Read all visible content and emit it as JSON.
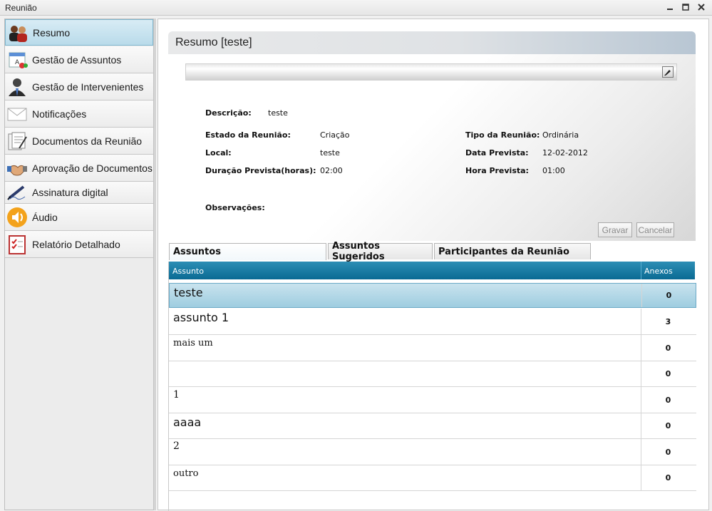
{
  "window": {
    "title": "Reunião"
  },
  "sidebar": {
    "items": [
      {
        "label": "Resumo",
        "icon": "people-icon"
      },
      {
        "label": "Gestão de Assuntos",
        "icon": "topics-icon"
      },
      {
        "label": "Gestão de Intervenientes",
        "icon": "person-icon"
      },
      {
        "label": "Notificações",
        "icon": "envelope-icon"
      },
      {
        "label": "Documentos da Reunião",
        "icon": "documents-icon"
      },
      {
        "label": "Aprovação de Documentos",
        "icon": "handshake-icon"
      },
      {
        "label": "Assinatura digital",
        "icon": "pen-icon"
      },
      {
        "label": "Áudio",
        "icon": "speaker-icon"
      },
      {
        "label": "Relatório Detalhado",
        "icon": "report-icon"
      }
    ]
  },
  "panel": {
    "title": "Resumo [teste]",
    "fields": {
      "descricao_label": "Descrição:",
      "descricao_value": "teste",
      "estado_label": "Estado da Reunião:",
      "estado_value": "Criação",
      "local_label": "Local:",
      "local_value": "teste",
      "duracao_label": "Duração Prevista(horas):",
      "duracao_value": "02:00",
      "tipo_label": "Tipo da Reunião:",
      "tipo_value": "Ordinária",
      "data_label": "Data Prevista:",
      "data_value": "12-02-2012",
      "hora_label": "Hora Prevista:",
      "hora_value": "01:00",
      "obs_label": "Observações:"
    },
    "buttons": {
      "save": "Gravar",
      "cancel": "Cancelar"
    }
  },
  "tabs": [
    "Assuntos",
    "Assuntos Sugeridos",
    "Participantes da Reunião"
  ],
  "grid": {
    "columns": [
      "Assunto",
      "Anexos"
    ],
    "rows": [
      {
        "assunto": "teste",
        "anexos": "0"
      },
      {
        "assunto": "assunto 1",
        "anexos": "3"
      },
      {
        "assunto": "mais um",
        "anexos": "0"
      },
      {
        "assunto": "",
        "anexos": "0"
      },
      {
        "assunto": "1",
        "anexos": "0"
      },
      {
        "assunto": "aaaa",
        "anexos": "0"
      },
      {
        "assunto": "2",
        "anexos": "0"
      },
      {
        "assunto": "outro",
        "anexos": "0"
      }
    ]
  }
}
